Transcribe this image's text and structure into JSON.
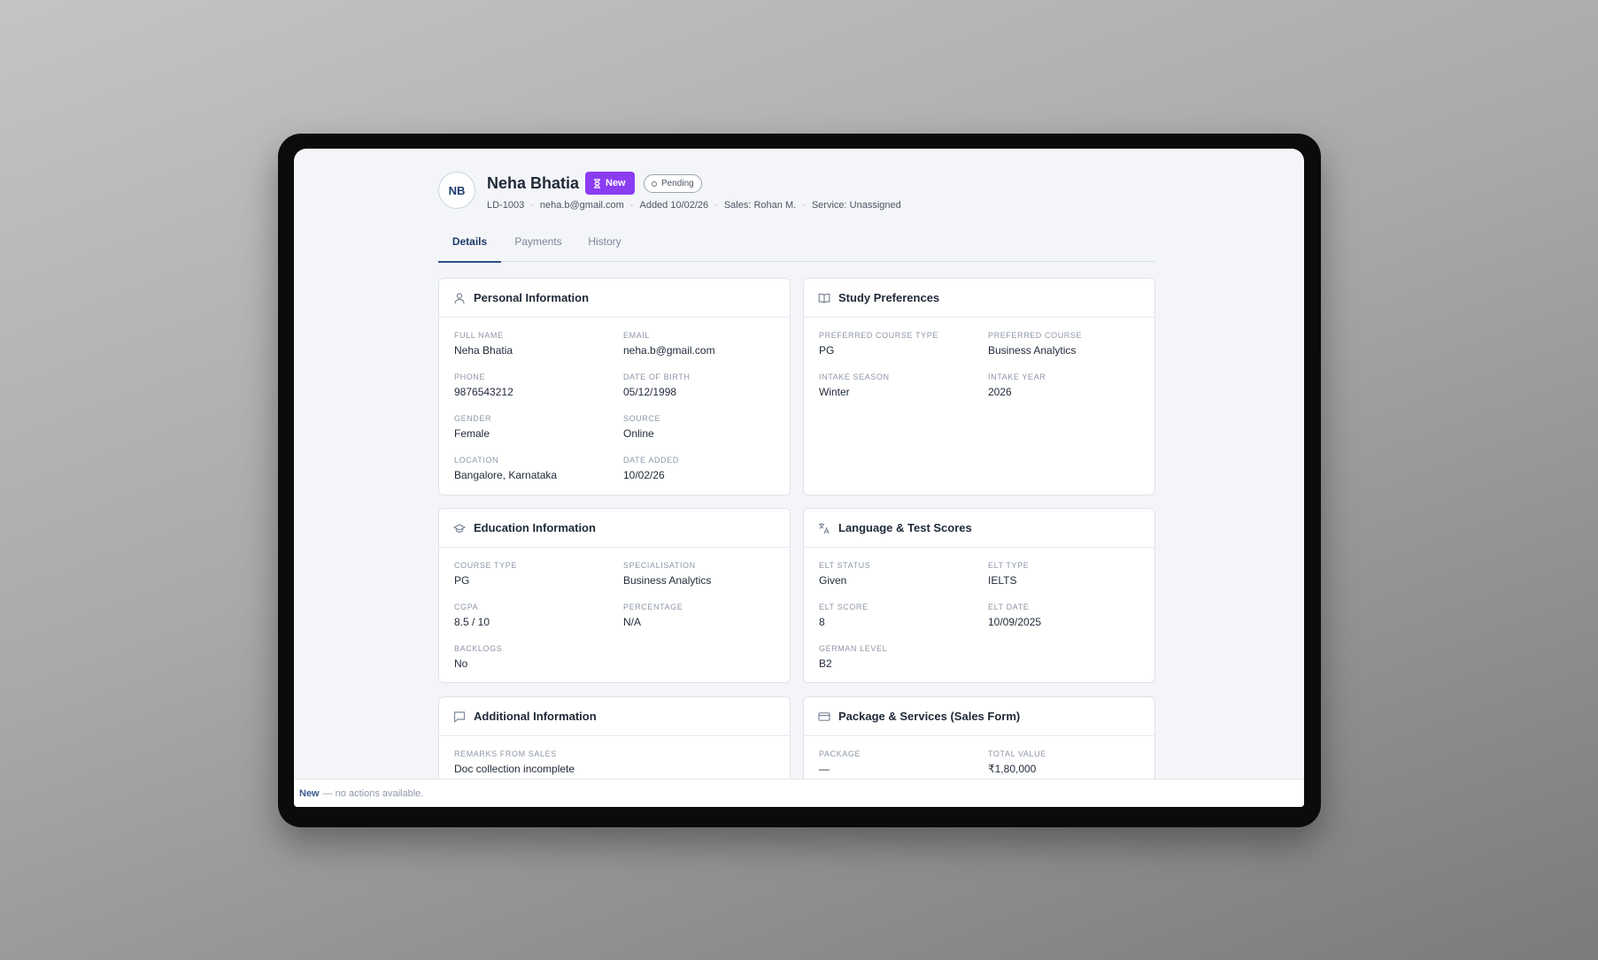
{
  "lead": {
    "initials": "NB",
    "name": "Neha Bhatia",
    "status_badge": "New",
    "pending_badge": "Pending",
    "meta": [
      "LD-1003",
      "neha.b@gmail.com",
      "Added 10/02/26",
      "Sales: Rohan M.",
      "Service: Unassigned"
    ],
    "meta_separator": "·"
  },
  "colors": {
    "accent": "#8b3df2",
    "primary": "#1e3a6b",
    "tab_active": "#2d4f86",
    "muted": "#8d97a7"
  },
  "tabs": [
    {
      "label": "Details",
      "active": true
    },
    {
      "label": "Payments",
      "active": false
    },
    {
      "label": "History",
      "active": false
    }
  ],
  "cards": {
    "personal": {
      "title": "Personal Information",
      "icon": "user-icon",
      "fields": [
        {
          "label": "Full Name",
          "value": "Neha Bhatia"
        },
        {
          "label": "Email",
          "value": "neha.b@gmail.com"
        },
        {
          "label": "Phone",
          "value": "9876543212"
        },
        {
          "label": "Date of Birth",
          "value": "05/12/1998"
        },
        {
          "label": "Gender",
          "value": "Female"
        },
        {
          "label": "Source",
          "value": "Online"
        },
        {
          "label": "Location",
          "value": "Bangalore, Karnataka"
        },
        {
          "label": "Date Added",
          "value": "10/02/26"
        }
      ]
    },
    "study": {
      "title": "Study Preferences",
      "icon": "book-open-icon",
      "fields": [
        {
          "label": "Preferred Course Type",
          "value": "PG"
        },
        {
          "label": "Preferred Course",
          "value": "Business Analytics"
        },
        {
          "label": "Intake Season",
          "value": "Winter"
        },
        {
          "label": "Intake Year",
          "value": "2026"
        }
      ]
    },
    "education": {
      "title": "Education Information",
      "icon": "graduation-cap-icon",
      "fields": [
        {
          "label": "Course Type",
          "value": "PG"
        },
        {
          "label": "Specialisation",
          "value": "Business Analytics"
        },
        {
          "label": "CGPA",
          "value": "8.5 / 10"
        },
        {
          "label": "Percentage",
          "value": "N/A"
        },
        {
          "label": "Backlogs",
          "value": "No"
        }
      ]
    },
    "language": {
      "title": "Language & Test Scores",
      "icon": "translate-icon",
      "fields": [
        {
          "label": "ELT Status",
          "value": "Given"
        },
        {
          "label": "ELT Type",
          "value": "IELTS"
        },
        {
          "label": "ELT Score",
          "value": "8"
        },
        {
          "label": "ELT Date",
          "value": "10/09/2025"
        },
        {
          "label": "German Level",
          "value": "B2"
        }
      ]
    },
    "additional": {
      "title": "Additional Information",
      "icon": "message-square-icon",
      "fields": [
        {
          "label": "Remarks from Sales",
          "value": "Doc collection incomplete"
        }
      ]
    },
    "package": {
      "title": "Package & Services (Sales Form)",
      "icon": "credit-card-icon",
      "fields": [
        {
          "label": "Package",
          "value": "—"
        },
        {
          "label": "Total Value",
          "value": "₹1,80,000"
        }
      ]
    }
  },
  "status_bar": {
    "status": "New",
    "message": "— no actions available."
  }
}
